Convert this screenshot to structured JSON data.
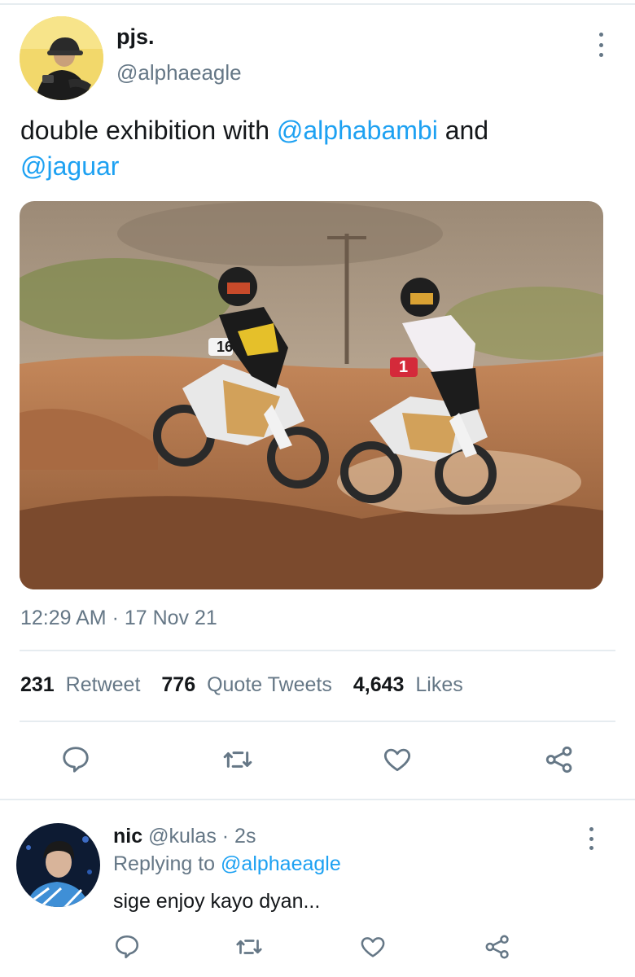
{
  "tweet": {
    "author": {
      "name": "pjs.",
      "handle": "@alphaeagle"
    },
    "text_parts": {
      "before": "double exhibition with ",
      "mention1": "@alphabambi",
      "middle": " and ",
      "mention2": "@jaguar"
    },
    "media": {
      "description": "two motocross riders jumping dirt track",
      "bike_numbers": [
        "16",
        "1"
      ]
    },
    "timestamp": "12:29 AM · 17 Nov 21",
    "stats": [
      {
        "count": "231",
        "label": "Retweet"
      },
      {
        "count": "776",
        "label": "Quote Tweets"
      },
      {
        "count": "4,643",
        "label": "Likes"
      }
    ],
    "actions": [
      "reply-icon",
      "retweet-icon",
      "like-icon",
      "share-icon"
    ]
  },
  "reply": {
    "author": {
      "name": "nic",
      "handle": "@kulas",
      "time": "· 2s"
    },
    "replying_label": "Replying to ",
    "replying_handle": "@alphaeagle",
    "text": "sige enjoy kayo dyan..."
  },
  "colors": {
    "accent": "#1da1f2",
    "secondary_text": "#657786",
    "divider": "#e6ecf0",
    "icon": "#657786"
  }
}
